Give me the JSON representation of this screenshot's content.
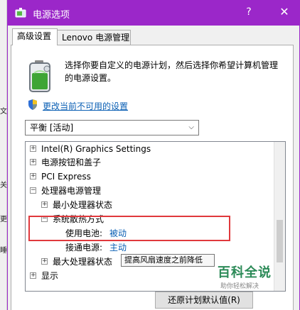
{
  "window": {
    "title": "电源选项",
    "help_label": "?",
    "close_label": "✕"
  },
  "tabs": [
    {
      "label": "高级设置",
      "active": true
    },
    {
      "label": "Lenovo 电源管理",
      "active": false
    }
  ],
  "description": {
    "line1": "选择你要自定义的电源计划，然后选择你希望计算机管理",
    "line2": "的电源设置。"
  },
  "change_link": "更改当前不可用的设置",
  "plan_select": {
    "value": "平衡 [活动]"
  },
  "tree": {
    "items": [
      {
        "label": "Intel(R) Graphics Settings",
        "expander": "+"
      },
      {
        "label": "电源按钮和盖子",
        "expander": "+"
      },
      {
        "label": "PCI Express",
        "expander": "+"
      },
      {
        "label": "处理器电源管理",
        "expander": "−"
      },
      {
        "label": "最小处理器状态",
        "expander": "+"
      },
      {
        "label": "系统散热方式",
        "expander": "−"
      },
      {
        "label": "使用电池:",
        "value": "被动"
      },
      {
        "label": "接通电源:",
        "value": "主动"
      },
      {
        "label": "最大处理器状态",
        "expander": "+"
      },
      {
        "label": "显示",
        "expander": "+"
      }
    ]
  },
  "tooltip": "提高风扇速度之前降低",
  "restore_button": "还原计划默认值(R)",
  "watermark": {
    "title": "百科全说",
    "subtitle": "助你轻松解决"
  },
  "background": {
    "fragments": [
      "文",
      "关",
      "更",
      "睡"
    ]
  },
  "colors": {
    "titlebar": "#9b27c9",
    "link": "#0a5fb4",
    "highlight": "#e0383c",
    "watermark": "#2b8a57"
  }
}
